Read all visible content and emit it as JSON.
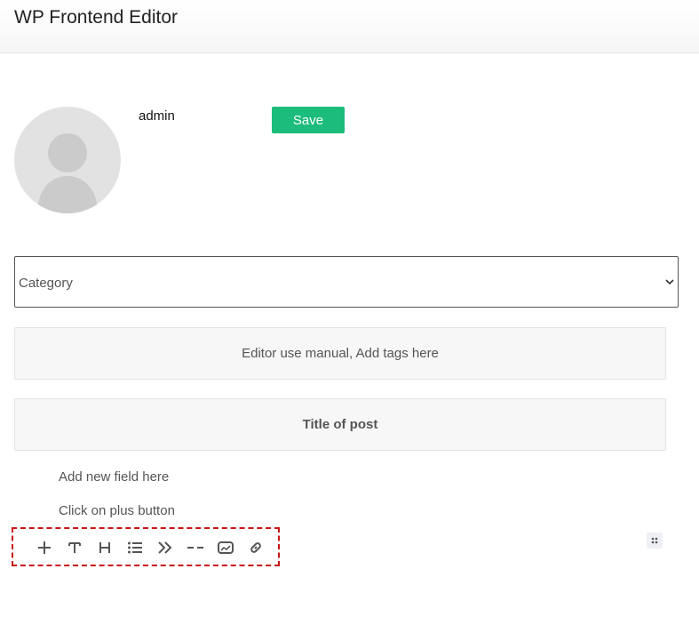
{
  "header": {
    "title": "WP Frontend Editor"
  },
  "profile": {
    "username": "admin",
    "avatar_icon": "user-avatar-icon"
  },
  "actions": {
    "save_label": "Save",
    "save_color": "#1cbc7c"
  },
  "category_select": {
    "selected": "Category"
  },
  "tags_panel": {
    "text": "Editor use manual, Add tags here"
  },
  "title_panel": {
    "text": "Title of post"
  },
  "hints": {
    "add_field": "Add new field here",
    "click_plus": "Click on plus button"
  },
  "toolbar": {
    "tools": [
      "plus-icon",
      "text-icon",
      "heading-icon",
      "list-icon",
      "quote-icon",
      "delimiter-icon",
      "image-icon",
      "link-icon"
    ],
    "highlight_color": "#c81414"
  },
  "drag_handle": {
    "icon": "drag-handle-icon"
  }
}
